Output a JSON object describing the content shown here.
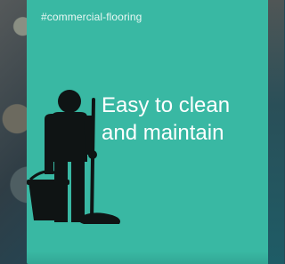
{
  "hashtag": "#commercial-flooring",
  "headline": {
    "line1": "Easy to clean",
    "line2": "and maintain"
  },
  "colors": {
    "card": "#39b8a3",
    "text": "#ffffff",
    "icon": "#0f1414"
  },
  "icons": {
    "figure": "janitor-with-mop-and-bucket-icon"
  }
}
